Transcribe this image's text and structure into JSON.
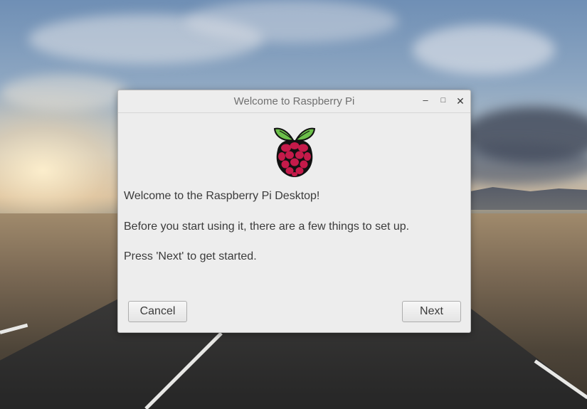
{
  "window": {
    "title": "Welcome to Raspberry Pi",
    "controls": {
      "minimize": "‒",
      "maximize": "□",
      "close": "✕"
    }
  },
  "logo": {
    "icon": "raspberry-pi-logo",
    "leaf_color": "#6cc04a",
    "berry_color": "#c51a4a"
  },
  "content": {
    "line1": "Welcome to the Raspberry Pi Desktop!",
    "line2": "Before you start using it, there are a few things to set up.",
    "line3": "Press 'Next' to get started."
  },
  "buttons": {
    "cancel": "Cancel",
    "next": "Next"
  }
}
